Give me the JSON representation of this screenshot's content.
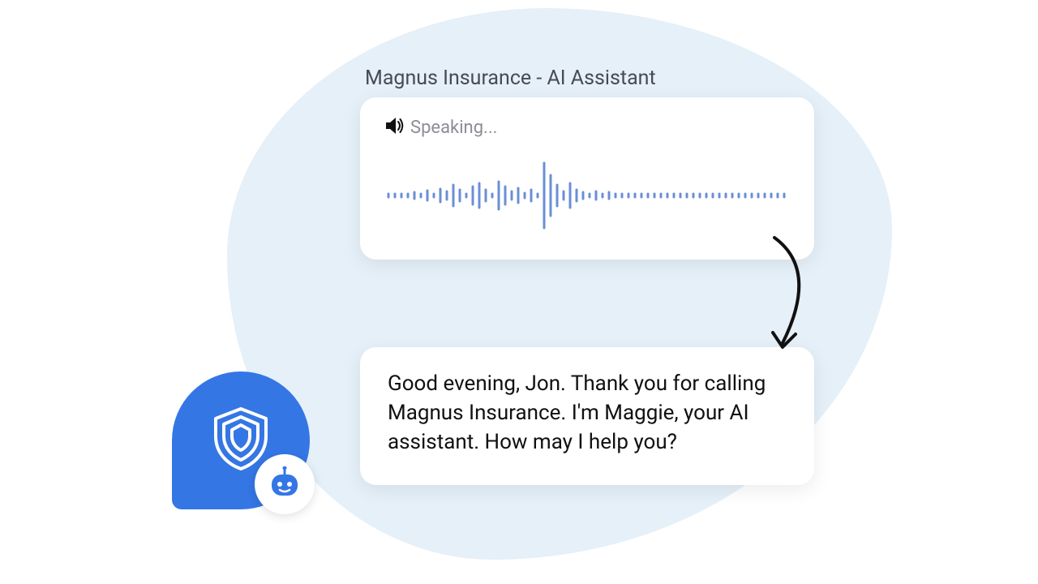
{
  "title": "Magnus Insurance - AI Assistant",
  "audio": {
    "status_label": "Speaking..."
  },
  "transcript": "Good evening, Jon. Thank you for calling Magnus Insurance. I'm Maggie, your AI assistant. How may I help you?",
  "colors": {
    "accent": "#3576e5",
    "blob": "#e5f0f8",
    "wave": "#6a8fd6"
  },
  "icons": {
    "speaker": "speaker-icon",
    "shield": "shield-icon",
    "bot": "bot-icon"
  }
}
